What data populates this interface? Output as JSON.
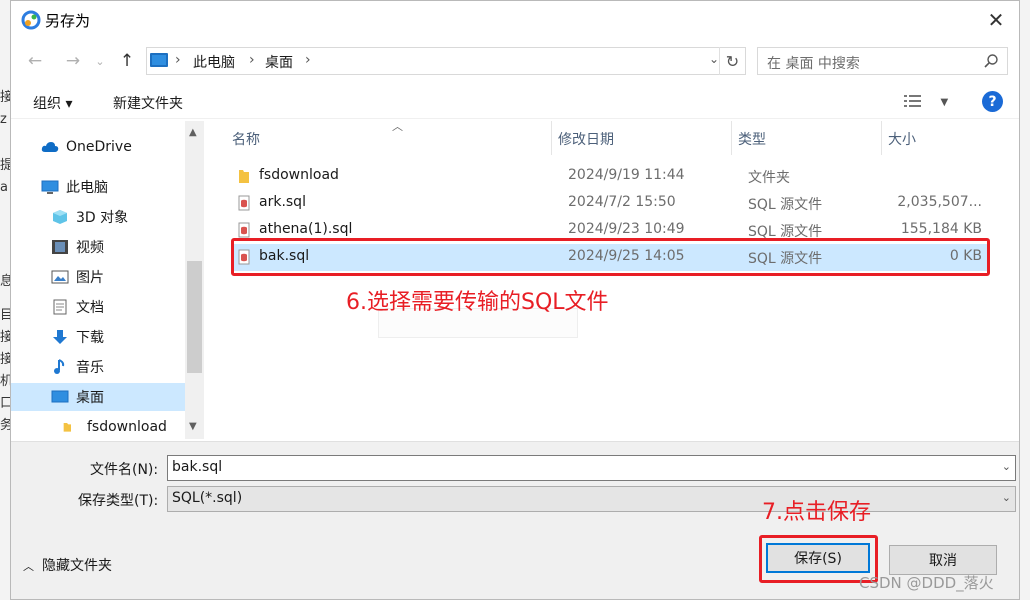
{
  "window": {
    "title": "另存为",
    "close": "✕"
  },
  "background_app": {
    "left_chars": [
      "接",
      "z",
      "提",
      "a",
      "息",
      "目",
      "接",
      "接",
      "机",
      "口",
      "务"
    ]
  },
  "address_bar": {
    "crumbs": [
      "此电脑",
      "桌面"
    ],
    "search_placeholder": "在 桌面 中搜索"
  },
  "toolbar": {
    "organize": "组织 ▾",
    "new_folder": "新建文件夹",
    "help": "?"
  },
  "nav_pane": {
    "items": [
      {
        "label": "OneDrive",
        "icon": "cloud-icon"
      },
      {
        "label": "此电脑",
        "icon": "computer-icon"
      },
      {
        "label": "3D 对象",
        "icon": "cube-icon"
      },
      {
        "label": "视频",
        "icon": "video-icon"
      },
      {
        "label": "图片",
        "icon": "picture-icon"
      },
      {
        "label": "文档",
        "icon": "document-icon"
      },
      {
        "label": "下载",
        "icon": "download-icon"
      },
      {
        "label": "音乐",
        "icon": "music-icon"
      },
      {
        "label": "桌面",
        "icon": "desktop-icon",
        "selected": true
      },
      {
        "label": "fsdownload",
        "icon": "folder-icon"
      }
    ]
  },
  "file_list": {
    "columns": [
      "名称",
      "修改日期",
      "类型",
      "大小"
    ],
    "rows": [
      {
        "name": "fsdownload",
        "date": "2024/9/19 11:44",
        "type": "文件夹",
        "size": "",
        "icon": "folder-icon"
      },
      {
        "name": "ark.sql",
        "date": "2024/7/2 15:50",
        "type": "SQL 源文件",
        "size": "2,035,507...",
        "icon": "sql-file-icon"
      },
      {
        "name": "athena(1).sql",
        "date": "2024/9/23 10:49",
        "type": "SQL 源文件",
        "size": "155,184 KB",
        "icon": "sql-file-icon"
      },
      {
        "name": "bak.sql",
        "date": "2024/9/25 14:05",
        "type": "SQL 源文件",
        "size": "0 KB",
        "icon": "sql-file-icon",
        "selected": true
      }
    ]
  },
  "annotations": {
    "step6": "6.选择需要传输的SQL文件",
    "step7": "7.点击保存",
    "color": "#e81e25"
  },
  "bottom": {
    "filename_label": "文件名(N):",
    "filename_value": "bak.sql",
    "filetype_label": "保存类型(T):",
    "filetype_value": "SQL(*.sql)",
    "hide_folders": "隐藏文件夹",
    "save": "保存(S)",
    "cancel": "取消"
  },
  "watermark": "CSDN @DDD_落火",
  "colors": {
    "accent": "#0078d7",
    "selection": "#cce8ff",
    "help": "#1a6ad6"
  }
}
